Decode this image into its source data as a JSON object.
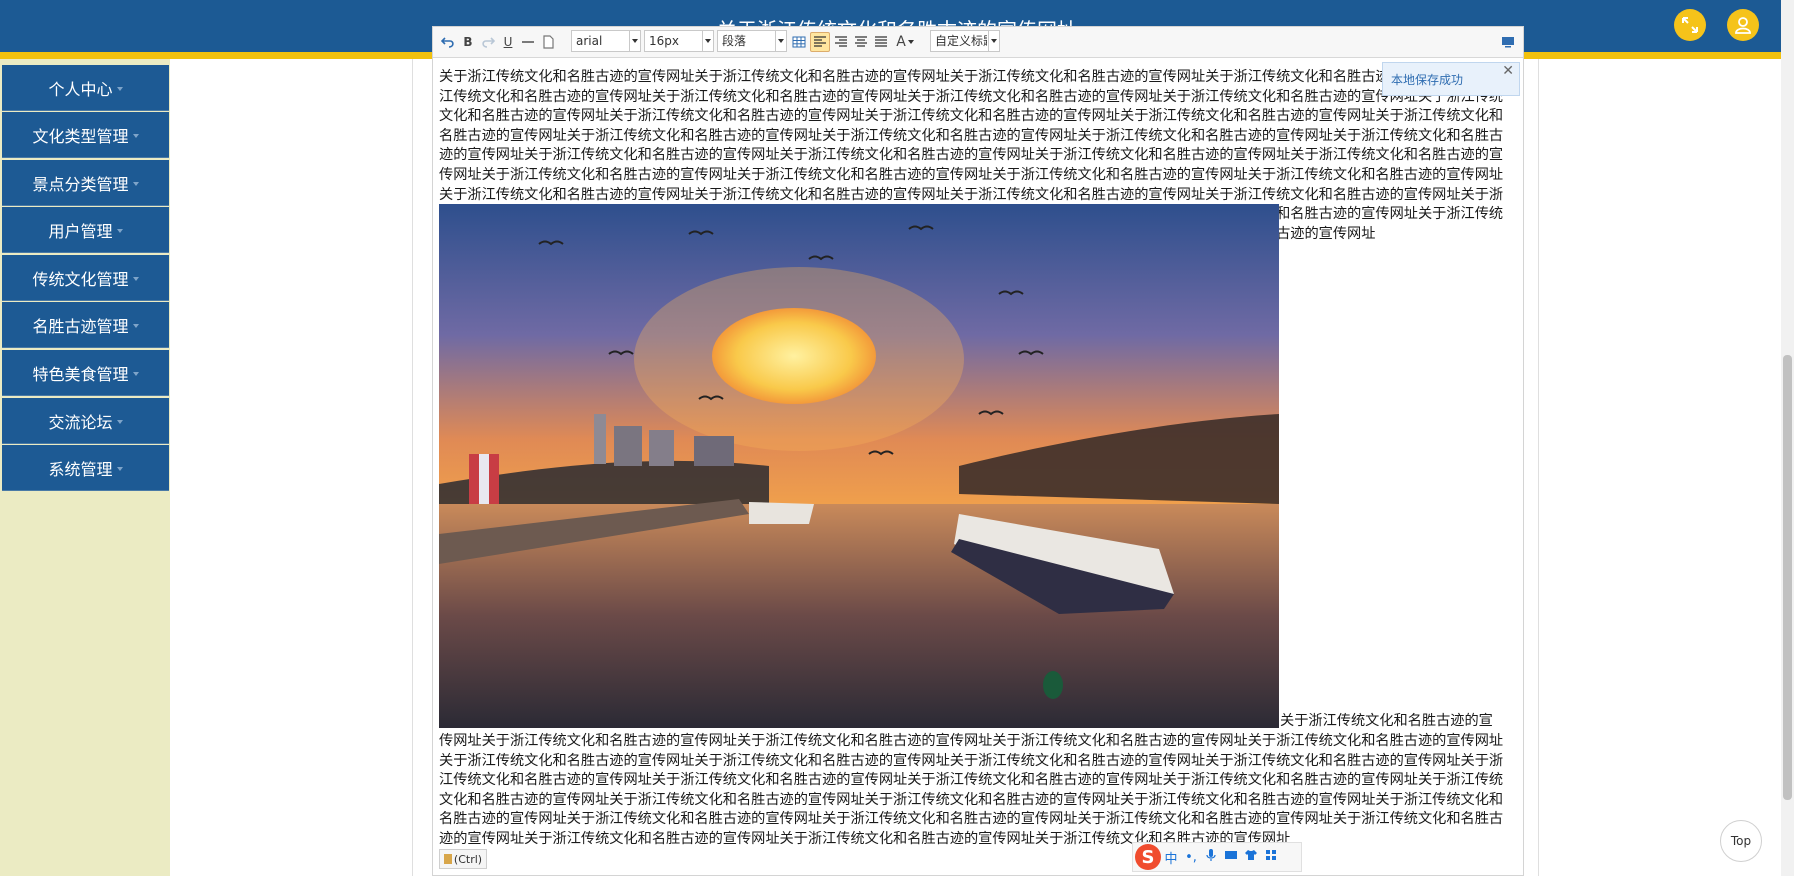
{
  "header": {
    "title": "关于浙江传统文化和名胜古迹的宣传网址",
    "fullscreen_icon": "expand-icon",
    "user_icon": "user-icon",
    "colors": {
      "bar": "#1c5a94",
      "stripe": "#f1c10e",
      "buttons": "#f5c31a"
    }
  },
  "sidebar": {
    "items": [
      {
        "label": "个人中心"
      },
      {
        "label": "文化类型管理"
      },
      {
        "label": "景点分类管理"
      },
      {
        "label": "用户管理"
      },
      {
        "label": "传统文化管理"
      },
      {
        "label": "名胜古迹管理"
      },
      {
        "label": "特色美食管理"
      },
      {
        "label": "交流论坛"
      },
      {
        "label": "系统管理"
      }
    ]
  },
  "editor": {
    "toolbar": {
      "font_family": "arial",
      "font_size": "16px",
      "paragraph": "段落",
      "custom_title": "自定义标题",
      "bold": "B",
      "underline": "U",
      "font_color": "A"
    },
    "toast": "本地保存成功",
    "body_text_top": "关于浙江传统文化和名胜古迹的宣传网址关于浙江传统文化和名胜古迹的宣传网址关于浙江传统文化和名胜古迹的宣传网址关于浙江传统文化和名胜古迹的宣传网址关于浙江传统文化和名胜古迹的宣传网址关于浙江传统文化和名胜古迹的宣传网址关于浙江传统文化和名胜古迹的宣传网址关于浙江传统文化和名胜古迹的宣传网址关于浙江传统文化和名胜古迹的宣传网址关于浙江传统文化和名胜古迹的宣传网址关于浙江传统文化和名胜古迹的宣传网址关于浙江传统文化和名胜古迹的宣传网址关于浙江传统文化和名胜古迹的宣传网址关于浙江传统文化和名胜古迹的宣传网址关于浙江传统文化和名胜古迹的宣传网址关于浙江传统文化和名胜古迹的宣传网址关于浙江传统文化和名胜古迹的宣传网址关于浙江传统文化和名胜古迹的宣传网址关于浙江传统文化和名胜古迹的宣传网址关于浙江传统文化和名胜古迹的宣传网址关于浙江传统文化和名胜古迹的宣传网址关于浙江传统文化和名胜古迹的宣传网址关于浙江传统文化和名胜古迹的宣传网址关于浙江传统文化和名胜古迹的宣传网址关于浙江传统文化和名胜古迹的宣传网址关于浙江传统文化和名胜古迹的宣传网址关于浙江传统文化和名胜古迹的宣传网址关于浙江传统文化和名胜古迹的宣传网址关于浙江传统文化和名胜古迹的宣传网址关于浙江传统文化和名胜古迹的宣传网址关于浙江传统文化和名胜古迹的宣传网址关于浙江传统文化和名胜古迹的宣传网址关于浙江传统文化和名胜古迹的宣传网址关于浙江传统文化和名胜古迹的宣传网址关于浙江传统文化和名胜古迹的宣传网址关于浙江传统文化和名胜古迹的宣传网址关于浙江传统文化和名胜古迹的宣传网址",
    "body_text_after_image": "关于浙江传统文化和名胜古迹的宣",
    "body_text_bottom": "传网址关于浙江传统文化和名胜古迹的宣传网址关于浙江传统文化和名胜古迹的宣传网址关于浙江传统文化和名胜古迹的宣传网址关于浙江传统文化和名胜古迹的宣传网址关于浙江传统文化和名胜古迹的宣传网址关于浙江传统文化和名胜古迹的宣传网址关于浙江传统文化和名胜古迹的宣传网址关于浙江传统文化和名胜古迹的宣传网址关于浙江传统文化和名胜古迹的宣传网址关于浙江传统文化和名胜古迹的宣传网址关于浙江传统文化和名胜古迹的宣传网址关于浙江传统文化和名胜古迹的宣传网址关于浙江传统文化和名胜古迹的宣传网址关于浙江传统文化和名胜古迹的宣传网址关于浙江传统文化和名胜古迹的宣传网址关于浙江传统文化和名胜古迹的宣传网址关于浙江传统文化和名胜古迹的宣传网址关于浙江传统文化和名胜古迹的宣传网址关于浙江传统文化和名胜古迹的宣传网址关于浙江传统文化和名胜古迹的宣传网址关于浙江传统文化和名胜古迹的宣传网址关于浙江传统文化和名胜古迹的宣传网址关于浙江传统文化和名胜古迹的宣传网址关于浙江传统文化和名胜古迹的宣传网址",
    "paste_label": "(Ctrl)"
  },
  "ime": {
    "logo": "S",
    "lang": "中",
    "punct": "•,"
  },
  "scroll_top_label": "Top"
}
